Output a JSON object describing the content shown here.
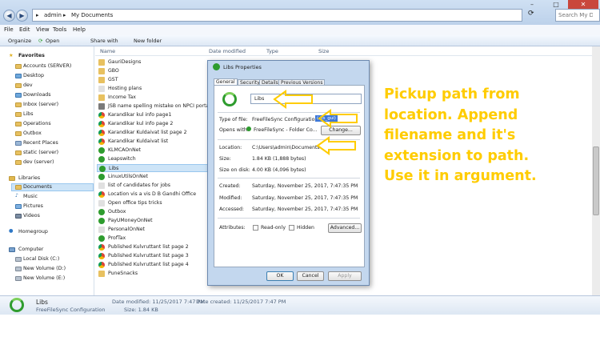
{
  "address": {
    "segments": [
      "admin",
      "My Documents"
    ]
  },
  "search": {
    "placeholder": "Search My Documents"
  },
  "menu": [
    "File",
    "Edit",
    "View",
    "Tools",
    "Help"
  ],
  "commands": [
    "Organize",
    "Open",
    "Share with",
    "New folder"
  ],
  "nav": {
    "favorites_header": "Favorites",
    "favorites": [
      "Accounts (SERVER)",
      "Desktop",
      "dev",
      "Downloads",
      "Inbox (server)",
      "Libs",
      "Operations",
      "Outbox",
      "Recent Places",
      "static (server)",
      "dev (server)"
    ],
    "libraries_header": "Libraries",
    "libraries": [
      "Documents",
      "Music",
      "Pictures",
      "Videos"
    ],
    "homegroup": "Homegroup",
    "computer_header": "Computer",
    "drives": [
      "Local Disk (C:)",
      "New Volume (D:)",
      "New Volume (E:)"
    ]
  },
  "columns": [
    "Name",
    "Date modified",
    "Type",
    "Size"
  ],
  "files": [
    "GauriDesigns",
    "GBO",
    "GST",
    "Hosting plans",
    "Income Tax",
    "JSB name spelling mistake on NPCI portal",
    "Karandikar kul info page1",
    "Karandikar kul info page 2",
    "Karandikar Kuldaivat list page 2",
    "Karandikar Kuldaivat list",
    "KLMCAOnNet",
    "Leapswitch",
    "Libs",
    "LinuxUtilsOnNet",
    "list of candidates for jobs",
    "Location vis a vis D B Gandhi Office",
    "Open office tips tricks",
    "Outbox",
    "PayUMoneyOnNet",
    "PersonalOnNet",
    "ProfTax",
    "Published Kulvruttant list page 2",
    "Published Kulvruttant list page 3",
    "Published Kulvruttant list page 4",
    "PuneSnacks"
  ],
  "dialog": {
    "title": "Libs Properties",
    "tabs": [
      "General",
      "Security",
      "Details",
      "Previous Versions"
    ],
    "name_value": "Libs",
    "type_label": "Type of file:",
    "type_value": "FreeFileSync Configuration",
    "type_ext": "(.ffs_gui)",
    "opens_label": "Opens with:",
    "opens_value": "FreeFileSync - Folder Co...",
    "change_label": "Change...",
    "location_label": "Location:",
    "location_value": "C:\\Users\\admin\\Documents",
    "size_label": "Size:",
    "size_value": "1.84 KB (1,888 bytes)",
    "disk_label": "Size on disk:",
    "disk_value": "4.00 KB (4,096 bytes)",
    "created_label": "Created:",
    "created_value": "Saturday, November 25, 2017, 7:47:35 PM",
    "modified_label": "Modified:",
    "modified_value": "Saturday, November 25, 2017, 7:47:35 PM",
    "accessed_label": "Accessed:",
    "accessed_value": "Saturday, November 25, 2017, 7:47:35 PM",
    "attributes_label": "Attributes:",
    "readonly_label": "Read-only",
    "hidden_label": "Hidden",
    "advanced_label": "Advanced...",
    "ok_label": "OK",
    "cancel_label": "Cancel",
    "apply_label": "Apply"
  },
  "details": {
    "name": "Libs",
    "type": "FreeFileSync Configuration",
    "modified": "Date modified: 11/25/2017 7:47 PM",
    "created": "Date created: 11/25/2017 7:47 PM",
    "size": "Size: 1.84 KB"
  },
  "annotation": [
    "Pickup path from",
    "location. Append",
    "filename and it's",
    "extension to path.",
    "Use it in argument."
  ],
  "colors": {
    "annotation": "#ffcc00",
    "selection": "#cde4f7",
    "accent": "#2e9c2e"
  }
}
